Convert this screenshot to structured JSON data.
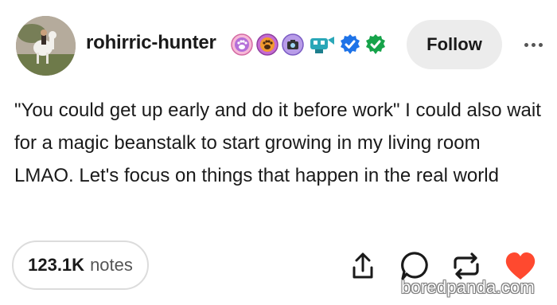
{
  "post": {
    "username": "rohirric-hunter",
    "follow_label": "Follow",
    "text": "\"You could get up early and do it before work\" I could also wait for a magic beanstalk to start growing in my living room LMAO. Let's focus on things that happen in the real world",
    "notes_count": "123.1K",
    "notes_label": "notes"
  },
  "badges": [
    "paw-pink-badge-icon",
    "paw-orange-badge-icon",
    "camera-badge-icon",
    "robot-badge-icon",
    "blue-checkmark-icon",
    "green-checkmark-icon"
  ],
  "actions": [
    "share-icon",
    "reply-icon",
    "reblog-icon",
    "like-heart-icon"
  ],
  "watermark": "boredpanda.com",
  "colors": {
    "follow_bg": "#ececec",
    "like_heart": "#ff492f",
    "check_blue": "#1e73e8",
    "check_green": "#16a34a"
  }
}
